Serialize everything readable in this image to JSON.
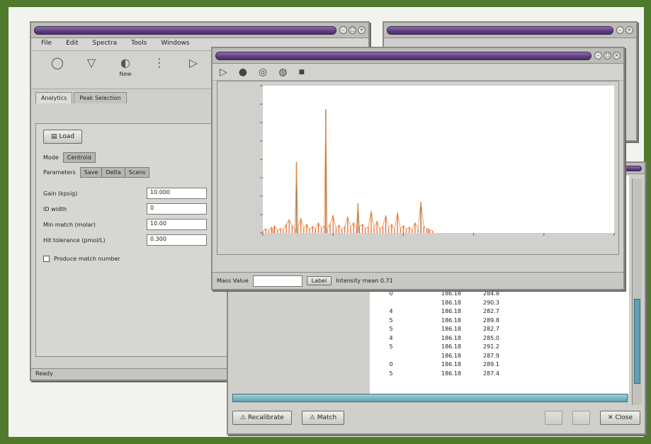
{
  "mainWindow": {
    "menu": [
      "File",
      "Edit",
      "Spectra",
      "Tools",
      "Windows"
    ],
    "toolbar": [
      {
        "label": "",
        "icon": "open-icon"
      },
      {
        "label": "",
        "icon": "filter-icon"
      },
      {
        "label": "New",
        "icon": "new-icon"
      },
      {
        "label": "",
        "icon": "separator-icon"
      },
      {
        "label": "",
        "icon": "forward-icon"
      }
    ],
    "tabs": [
      "Analytics",
      "Peak Selection"
    ],
    "loadButton": "Load",
    "modeLabel": "Mode",
    "modeValue": "Centroid",
    "paramLabel": "Parameters",
    "paramOptions": [
      "Save",
      "Delta",
      "Scans"
    ],
    "fields": [
      {
        "label": "Gain (kpsig)",
        "value": "10.000"
      },
      {
        "label": "ID width",
        "value": "0"
      },
      {
        "label": "Min match (molar)",
        "value": "10.00"
      },
      {
        "label": "Hit tolerance (pmol/L)",
        "value": "0.300"
      }
    ],
    "checkboxLabel": "Produce match number",
    "status": "Ready"
  },
  "chartWindow": {
    "footLabel": "Mass Value",
    "footButton": "Label",
    "footStatus": "Intensity mean 0.71"
  },
  "resultsWindow": {
    "rows": [
      [
        "0",
        "186.18",
        "284.8"
      ],
      [
        "",
        "186.18",
        "290.3"
      ],
      [
        "4",
        "186.18",
        "282.7"
      ],
      [
        "5",
        "186.18",
        "289.8"
      ],
      [
        "5",
        "186.18",
        "282.7"
      ],
      [
        "4",
        "186.18",
        "285.0"
      ],
      [
        "5",
        "186.18",
        "291.2"
      ],
      [
        "",
        "186.18",
        "287.9"
      ],
      [
        "0",
        "186.18",
        "289.1"
      ],
      [
        "5",
        "186.18",
        "287.4"
      ]
    ],
    "buttons": [
      "Recalibrate",
      "Match",
      "",
      "",
      "Close"
    ]
  },
  "chart_data": {
    "type": "line",
    "title": "",
    "xlabel": "",
    "ylabel": "",
    "x": [
      0,
      4,
      8,
      12,
      14,
      16,
      20,
      24,
      28,
      32,
      36,
      40,
      44,
      46,
      48,
      52,
      56,
      60,
      64,
      68,
      72,
      76,
      80,
      84,
      86,
      88,
      92,
      96,
      100,
      104,
      108,
      112,
      116,
      120,
      124,
      128,
      130,
      132,
      136,
      140,
      144,
      148,
      152,
      156,
      160,
      164,
      168,
      172,
      176,
      180,
      184,
      188,
      192,
      196,
      200,
      204,
      208,
      212,
      216,
      220,
      224,
      226,
      228,
      232
    ],
    "y": [
      2,
      6,
      3,
      8,
      4,
      10,
      3,
      6,
      4,
      12,
      18,
      10,
      5,
      96,
      8,
      20,
      6,
      12,
      4,
      9,
      5,
      14,
      6,
      10,
      168,
      6,
      12,
      24,
      6,
      11,
      5,
      9,
      22,
      8,
      14,
      6,
      40,
      9,
      12,
      6,
      8,
      30,
      7,
      16,
      5,
      9,
      24,
      6,
      12,
      4,
      28,
      6,
      10,
      5,
      8,
      4,
      14,
      6,
      42,
      9,
      5,
      6,
      4,
      3
    ],
    "xlim": [
      0,
      480
    ],
    "ylim": [
      0,
      200
    ],
    "grid": false
  }
}
